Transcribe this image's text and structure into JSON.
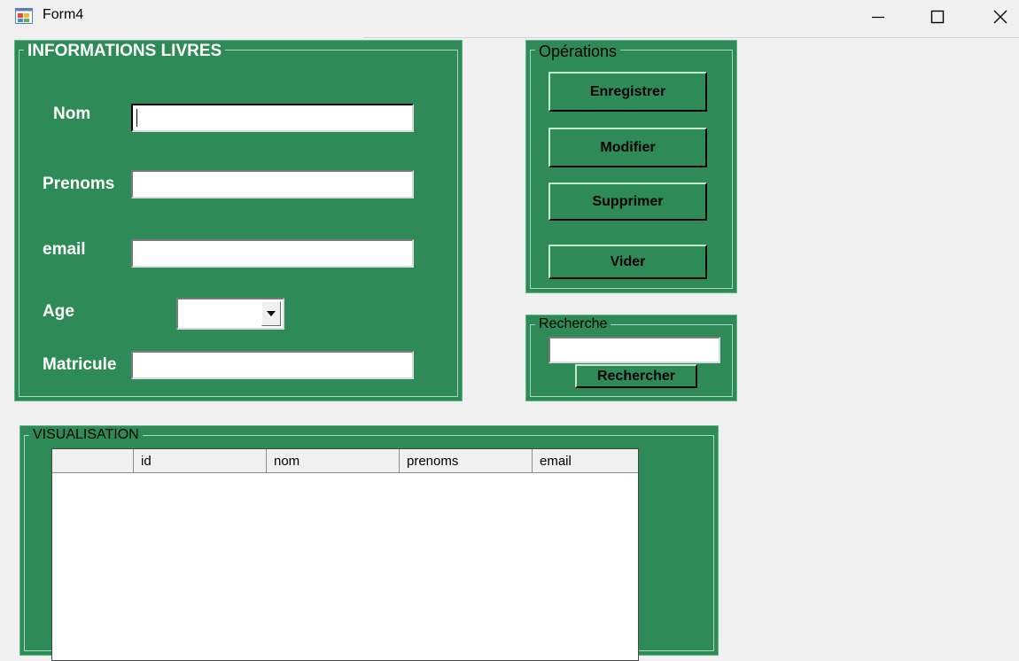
{
  "window": {
    "title": "Form4",
    "minimize_icon": "minimize-icon",
    "maximize_icon": "maximize-icon",
    "close_icon": "close-icon",
    "app_icon": "winforms-app-icon"
  },
  "colors": {
    "group_green": "#2e8b57",
    "window_bg": "#f0f0f0"
  },
  "info_group": {
    "title": "INFORMATIONS LIVRES",
    "fields": {
      "nom": {
        "label": "Nom",
        "value": ""
      },
      "prenoms": {
        "label": "Prenoms",
        "value": ""
      },
      "email": {
        "label": "email",
        "value": ""
      },
      "age": {
        "label": "Age",
        "selected": ""
      },
      "matricule": {
        "label": "Matricule",
        "value": ""
      }
    }
  },
  "operations": {
    "title": "Opérations",
    "buttons": {
      "save": "Enregistrer",
      "edit": "Modifier",
      "delete": "Supprimer",
      "clear": "Vider"
    }
  },
  "search": {
    "title": "Recherche",
    "value": "",
    "button": "Rechercher"
  },
  "visualisation": {
    "title": "VISUALISATION",
    "columns": [
      "",
      "id",
      "nom",
      "prenoms",
      "email"
    ],
    "rows": []
  }
}
